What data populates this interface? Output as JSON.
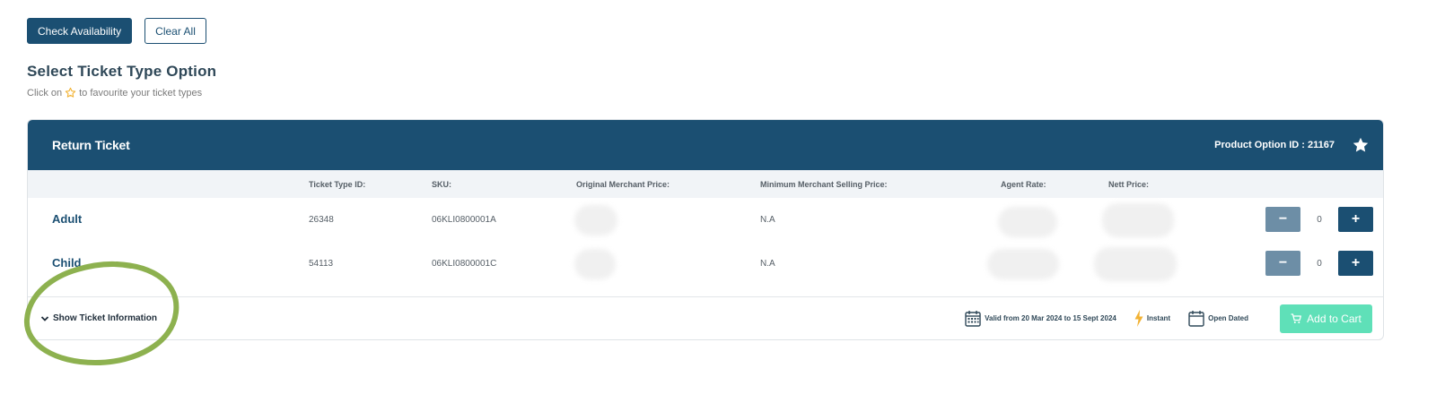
{
  "actions": {
    "check_availability": "Check Availability",
    "clear_all": "Clear All"
  },
  "section": {
    "title": "Select Ticket Type Option",
    "hint_prefix": "Click on",
    "hint_suffix": "to favourite your ticket types"
  },
  "card": {
    "title": "Return Ticket",
    "product_option_id": "Product Option ID : 21167",
    "columns": {
      "ticket_type_id": "Ticket Type ID:",
      "sku": "SKU:",
      "original_merchant_price": "Original Merchant Price:",
      "minimum_merchant_selling_price": "Minimum Merchant Selling Price:",
      "agent_rate": "Agent Rate:",
      "nett_price": "Nett Price:"
    },
    "tickets": [
      {
        "name": "Adult",
        "ticket_type_id": "26348",
        "sku": "06KLI0800001A",
        "min_selling_price": "N.A",
        "quantity": "0"
      },
      {
        "name": "Child",
        "ticket_type_id": "54113",
        "sku": "06KLI0800001C",
        "min_selling_price": "N.A",
        "quantity": "0"
      }
    ],
    "footer": {
      "show_info": "Show Ticket Information",
      "validity": "Valid from 20 Mar 2024 to 15 Sept 2024",
      "instant": "Instant",
      "open_dated": "Open Dated",
      "add_to_cart": "Add to Cart"
    }
  },
  "colors": {
    "primary": "#1b4f72",
    "minus_button": "#6d8ea6",
    "add_to_cart": "#5fe0b8",
    "star_outline": "#f2b233",
    "instant_bolt": "#f2b233",
    "highlight_ring": "#8db14f"
  },
  "icons": {
    "favourite_hint": "star-outline-icon",
    "favourite": "star-icon",
    "expand": "chevron-down-icon",
    "validity": "calendar-icon",
    "instant": "lightning-icon",
    "open_dated": "calendar-blank-icon",
    "cart": "cart-icon"
  }
}
